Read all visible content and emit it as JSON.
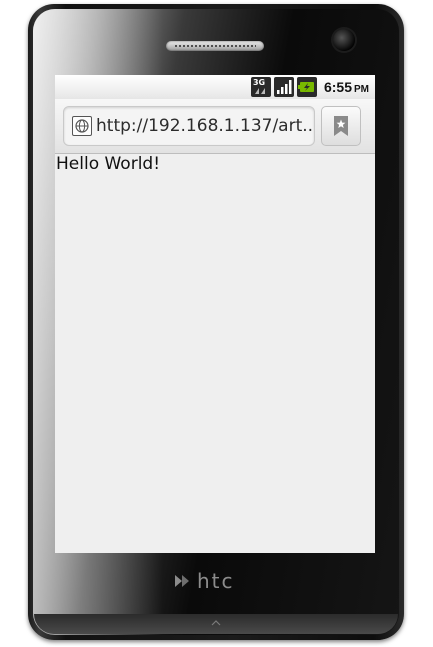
{
  "device": {
    "brand": "htc"
  },
  "status_bar": {
    "network_label": "3G",
    "time": "6:55",
    "ampm": "PM"
  },
  "browser": {
    "url": "http://192.168.1.137/art...",
    "icons": {
      "site": "globe-icon",
      "bookmark": "bookmark-star-icon"
    }
  },
  "page": {
    "text": "Hello World!"
  },
  "colors": {
    "screen_background": "#efefef",
    "status_bar_background": "#ffffff",
    "device_body": "#111111",
    "battery_green": "#79b900"
  }
}
